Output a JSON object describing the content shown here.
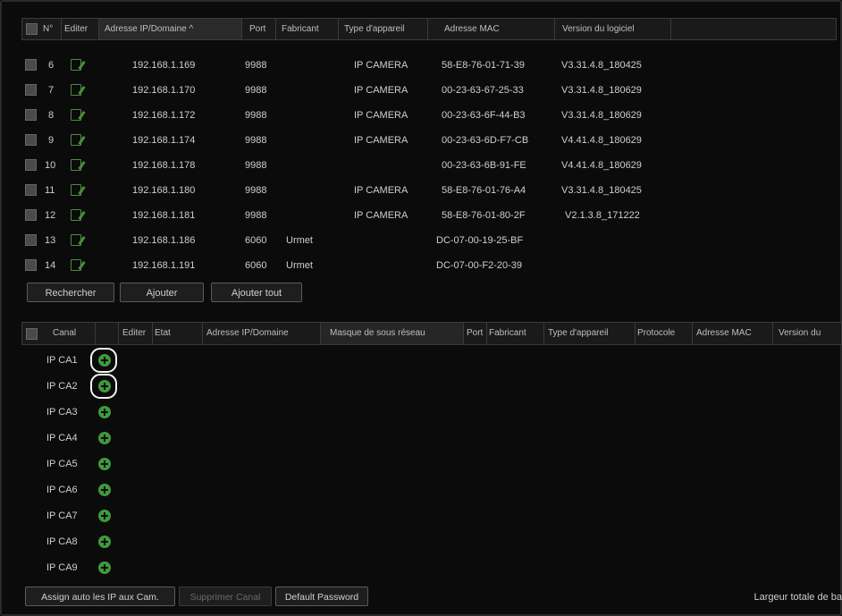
{
  "top_table": {
    "headers": [
      "N°",
      "Editer",
      "Adresse IP/Domaine ^",
      "Port",
      "Fabricant",
      "Type d'appareil",
      "Adresse MAC",
      "Version du logiciel"
    ],
    "rows": [
      {
        "n": "6",
        "ip": "192.168.1.169",
        "port": "9988",
        "fab": "",
        "type": "IP CAMERA",
        "mac": "58-E8-76-01-71-39",
        "ver": "V3.31.4.8_180425"
      },
      {
        "n": "7",
        "ip": "192.168.1.170",
        "port": "9988",
        "fab": "",
        "type": "IP CAMERA",
        "mac": "00-23-63-67-25-33",
        "ver": "V3.31.4.8_180629"
      },
      {
        "n": "8",
        "ip": "192.168.1.172",
        "port": "9988",
        "fab": "",
        "type": "IP CAMERA",
        "mac": "00-23-63-6F-44-B3",
        "ver": "V3.31.4.8_180629"
      },
      {
        "n": "9",
        "ip": "192.168.1.174",
        "port": "9988",
        "fab": "",
        "type": "IP CAMERA",
        "mac": "00-23-63-6D-F7-CB",
        "ver": "V4.41.4.8_180629"
      },
      {
        "n": "10",
        "ip": "192.168.1.178",
        "port": "9988",
        "fab": "",
        "type": "",
        "mac": "00-23-63-6B-91-FE",
        "ver": "V4.41.4.8_180629"
      },
      {
        "n": "11",
        "ip": "192.168.1.180",
        "port": "9988",
        "fab": "",
        "type": "IP CAMERA",
        "mac": "58-E8-76-01-76-A4",
        "ver": "V3.31.4.8_180425"
      },
      {
        "n": "12",
        "ip": "192.168.1.181",
        "port": "9988",
        "fab": "",
        "type": "IP CAMERA",
        "mac": "58-E8-76-01-80-2F",
        "ver": "V2.1.3.8_171222"
      },
      {
        "n": "13",
        "ip": "192.168.1.186",
        "port": "6060",
        "fab": "Urmet",
        "type": "",
        "mac": "DC-07-00-19-25-BF",
        "ver": ""
      },
      {
        "n": "14",
        "ip": "192.168.1.191",
        "port": "6060",
        "fab": "Urmet",
        "type": "",
        "mac": "DC-07-00-F2-20-39",
        "ver": ""
      }
    ]
  },
  "buttons": {
    "search": "Rechercher",
    "add": "Ajouter",
    "add_all": "Ajouter tout"
  },
  "bottom_table": {
    "headers": [
      "Canal",
      "",
      "Editer",
      "Etat",
      "Adresse IP/Domaine",
      "Masque de sous réseau",
      "Port",
      "Fabricant",
      "Type d'appareil",
      "Protocole",
      "Adresse MAC",
      "Version du"
    ],
    "channels": [
      "IP CA1",
      "IP CA2",
      "IP CA3",
      "IP CA4",
      "IP CA5",
      "IP CA6",
      "IP CA7",
      "IP CA8",
      "IP CA9"
    ]
  },
  "bottom_buttons": {
    "assign": "Assign auto les IP aux Cam.",
    "delete": "Supprimer Canal",
    "default": "Default Password"
  },
  "footer": {
    "bandwidth": "Largeur totale de ba"
  },
  "colors": {
    "accent": "#3f9a3a",
    "background": "#0b0b0b"
  }
}
